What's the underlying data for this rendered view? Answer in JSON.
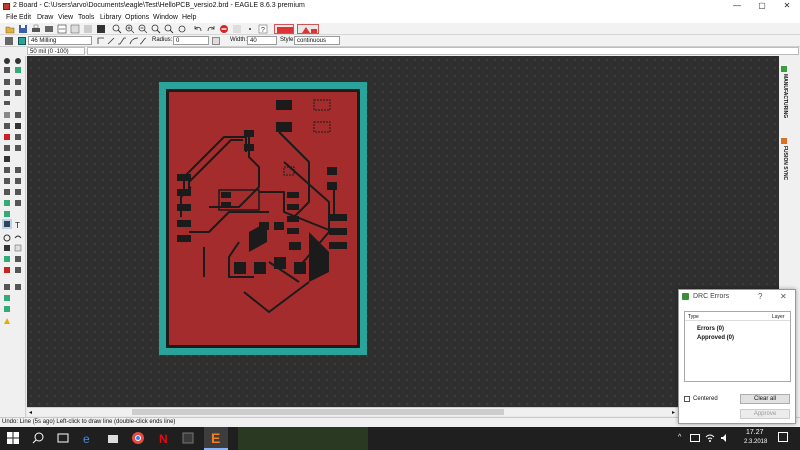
{
  "window": {
    "title": "2 Board - C:\\Users\\arvo\\Documents\\eagle\\Test\\HelloPCB_versio2.brd - EAGLE 8.6.3 premium",
    "min": "—",
    "max": "▢",
    "close": "✕"
  },
  "menu": [
    "File",
    "Edit",
    "Draw",
    "View",
    "Tools",
    "Library",
    "Options",
    "Window",
    "Help"
  ],
  "toolbar2": {
    "layer": "46 Milling",
    "radius_label": "Radius:",
    "radius_value": "0",
    "width_label": "Width:",
    "width_value": "40",
    "style_label": "Style:",
    "style_value": "continuous"
  },
  "coordinates": "50 mil (0 -100)",
  "side_tabs": {
    "manufacturing": "MANUFACTURING",
    "fusion": "FUSION SYNC"
  },
  "status": "Undo: Line (5s ago) Left-click to draw line (double-click ends line)",
  "drc": {
    "title": "DRC Errors",
    "help": "?",
    "col_type": "Type",
    "col_layer": "Layer",
    "errors": "Errors (0)",
    "approved": "Approved (0)",
    "centered": "Centered",
    "clear_all": "Clear all",
    "approve": "Approve"
  },
  "clock": {
    "time": "17.27",
    "date": "2.3.2018"
  },
  "colors": {
    "board_outline": "#2aa39a",
    "copper": "#a52c2c",
    "canvas": "#2f2f2f",
    "drc_icon": "#3b8f3b"
  }
}
